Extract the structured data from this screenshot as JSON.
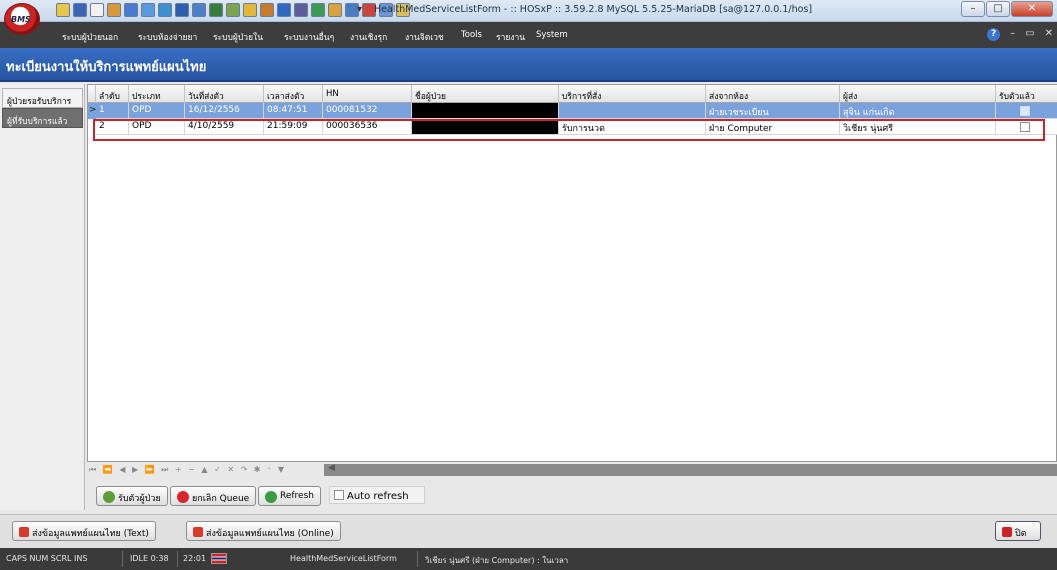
{
  "app": {
    "window_title": "HealthMedServiceListForm - :: HOSxP :: 3.59.2.8 MySQL 5.5.25-MariaDB [sa@127.0.0.1/hos]",
    "logo_text": "BMS",
    "quick_access_dropdown": "▾",
    "window_buttons": {
      "minimize": "–",
      "maximize": "□",
      "close": "✕"
    }
  },
  "menu": {
    "items": [
      "ระบบผู้ป่วยนอก",
      "ระบบห้องจ่ายยา",
      "ระบบผู้ป่วยใน",
      "ระบบงานอื่นๆ",
      "งานเชิงรุก",
      "งานจิตเวช",
      "Tools",
      "รายงาน",
      "System"
    ],
    "right": {
      "help": "?",
      "minimize": "–",
      "restore": "▭",
      "close": "✕"
    }
  },
  "header": {
    "title": "ทะเบียนงานให้บริการแพทย์แผนไทย"
  },
  "sidebar": {
    "tabs": [
      {
        "label": "ผู้ป่วยรอรับบริการ",
        "active": false
      },
      {
        "label": "ผู้ที่รับบริการแล้ว",
        "active": true
      }
    ]
  },
  "grid": {
    "columns": [
      "ลำดับ",
      "ประเภท",
      "วันที่ส่งตัว",
      "เวลาส่งตัว",
      "HN",
      "ชื่อผู้ป่วย",
      "บริการที่สั่ง",
      "ส่งจากห้อง",
      "ผู้ส่ง",
      "รับตัวแล้ว"
    ],
    "rows": [
      {
        "no": "1",
        "type": "OPD",
        "date": "16/12/2556",
        "time": "08:47:51",
        "hn": "000081532",
        "name": "",
        "service": "",
        "from_room": "ฝ่ายเวชระเบียน",
        "sender": "สุจิน แก่นเกิด",
        "received": false,
        "selected": true
      },
      {
        "no": "2",
        "type": "OPD",
        "date": "4/10/2559",
        "time": "21:59:09",
        "hn": "000036536",
        "name": "",
        "service": "รับการนวด",
        "from_room": "ฝ่าย Computer",
        "sender": "วิเชียร นุ่นศรี",
        "received": false,
        "selected": false
      }
    ],
    "row_indicator": ">",
    "pager": "⏮ ⏪ ◀ ▶ ⏩ ⏭ + − ▲ ✓ ✕ ↷ ✱ ⁺ ▼",
    "scroll_arrow": "◀"
  },
  "actions": {
    "receive_label": "รับตัวผู้ป่วย",
    "cancel_queue_label": "ยกเลิก Queue",
    "refresh_label": "Refresh",
    "auto_refresh_label": "Auto refresh",
    "send_text_label": "ส่งข้อมูลแพทย์แผนไทย (Text)",
    "send_online_label": "ส่งข้อมูลแพทย์แผนไทย (Online)",
    "close_label": "ปิด"
  },
  "status": {
    "keys": "CAPS  NUM  SCRL  INS",
    "idle": "IDLE 0:38",
    "time": "22:01",
    "form": "HealthMedServiceListForm",
    "user": "วิเชียร นุ่นศรี (ฝ่าย Computer) : ในเวลา"
  },
  "colors": {
    "menubar": "#3d3d3d",
    "header": "#2f62b5",
    "selected_row": "#7aa2dc",
    "highlight_frame": "#c4262e"
  }
}
